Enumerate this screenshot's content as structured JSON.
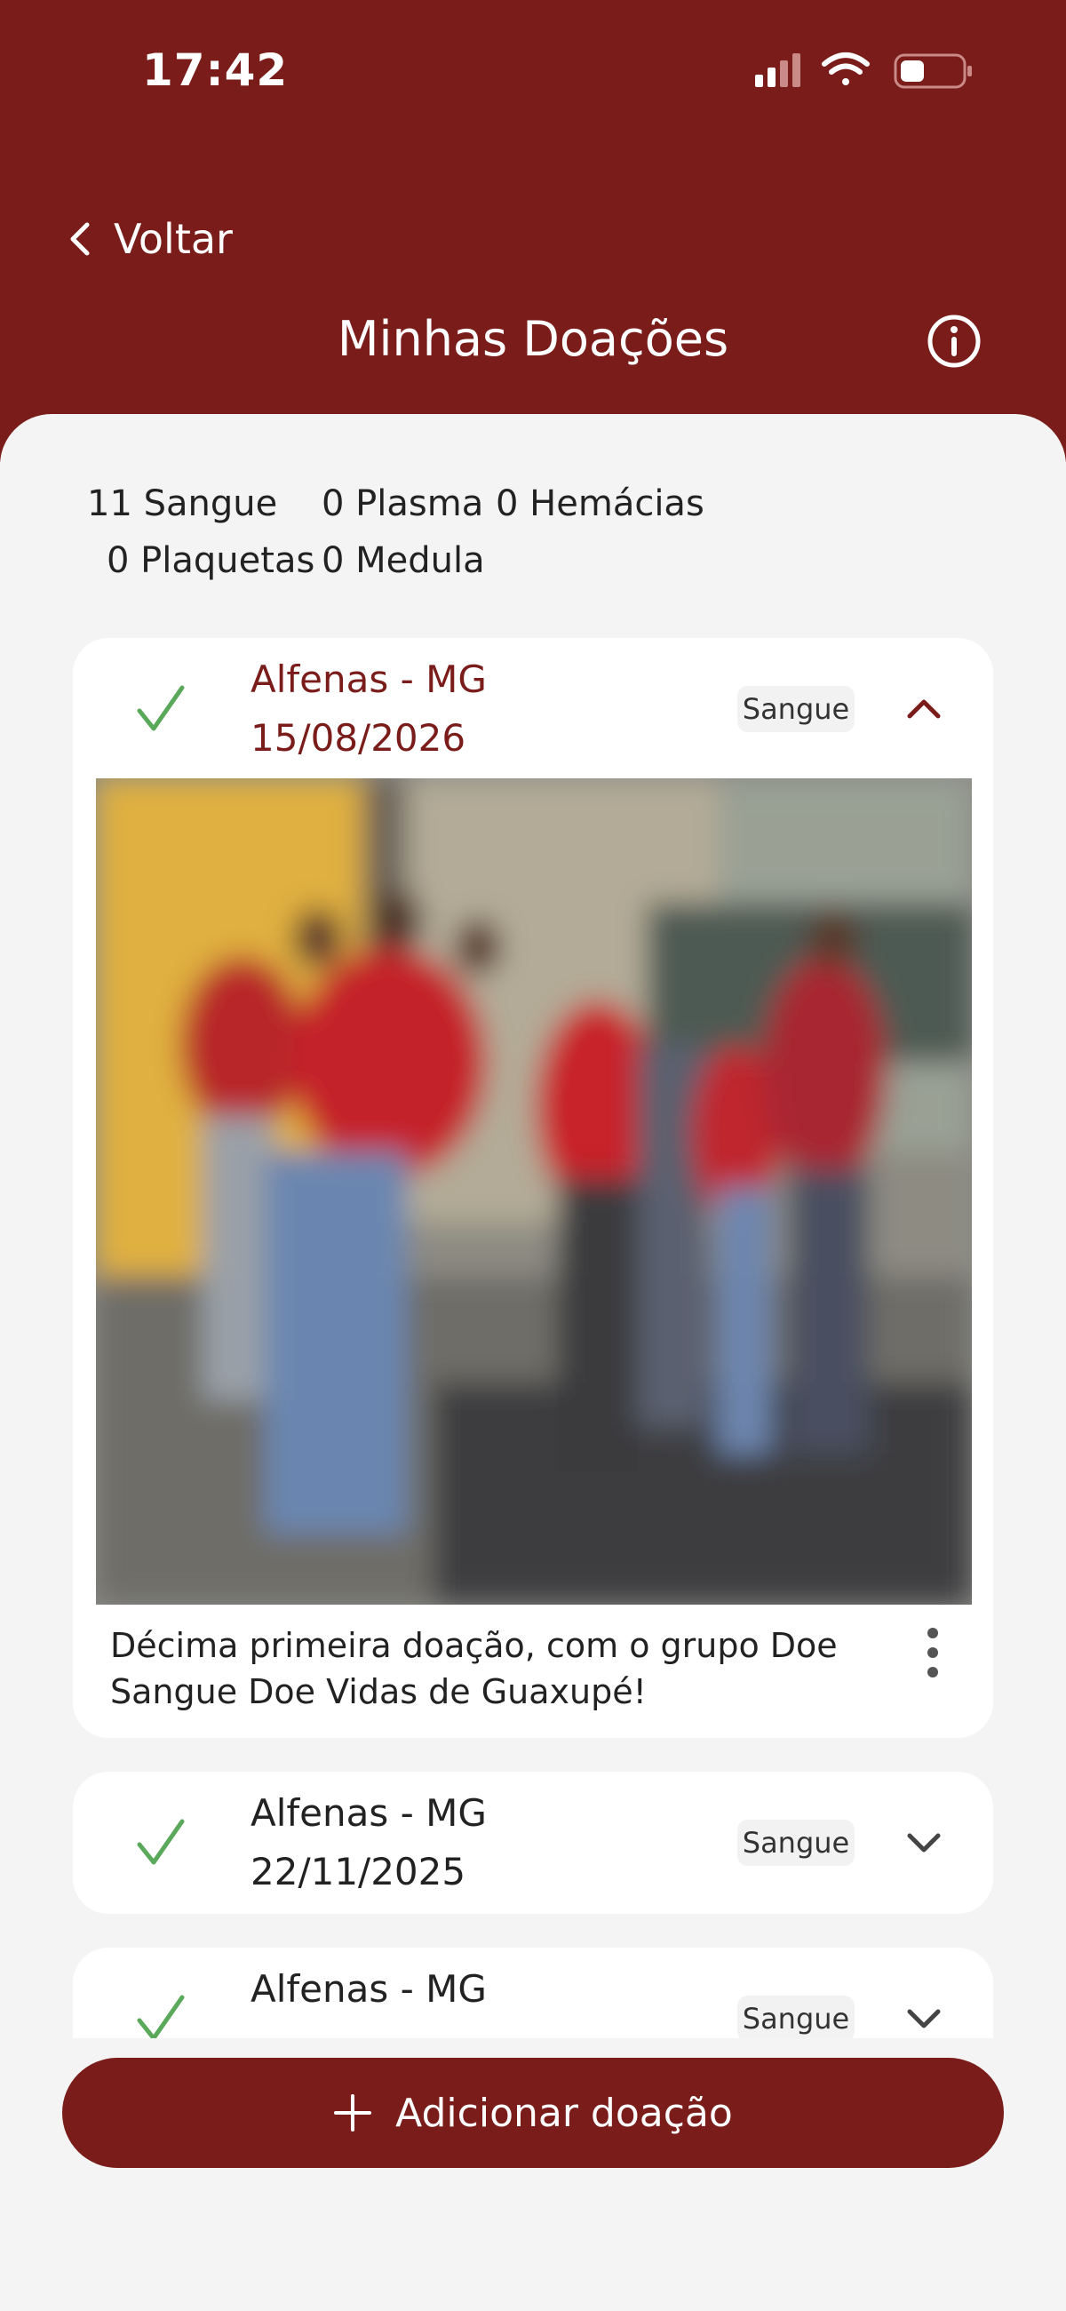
{
  "status_bar": {
    "time": "17:42"
  },
  "header": {
    "back_label": "Voltar",
    "title": "Minhas Doações"
  },
  "counts": {
    "sangue": "11 Sangue",
    "plasma": "0 Plasma",
    "hemacias": "0 Hemácias",
    "plaquetas": "0 Plaquetas",
    "medula": "0 Medula"
  },
  "donations": [
    {
      "location": "Alfenas - MG",
      "date": "15/08/2026",
      "type": "Sangue",
      "expanded": true,
      "caption": "Décima primeira doação, com o grupo Doe Sangue Doe Vidas de Guaxupé!"
    },
    {
      "location": "Alfenas - MG",
      "date": "22/11/2025",
      "type": "Sangue",
      "expanded": false
    },
    {
      "location": "Alfenas - MG",
      "type": "Sangue",
      "expanded": false
    }
  ],
  "add_button": {
    "label": "Adicionar doação"
  },
  "colors": {
    "brand": "#7a1c1a",
    "check": "#5aa85a",
    "background": "#f4f4f4"
  },
  "icons": [
    "chevron-left-icon",
    "info-icon",
    "check-icon",
    "chevron-up-icon",
    "chevron-down-icon",
    "more-vertical-icon",
    "plus-icon",
    "signal-icon",
    "wifi-icon",
    "battery-icon"
  ]
}
